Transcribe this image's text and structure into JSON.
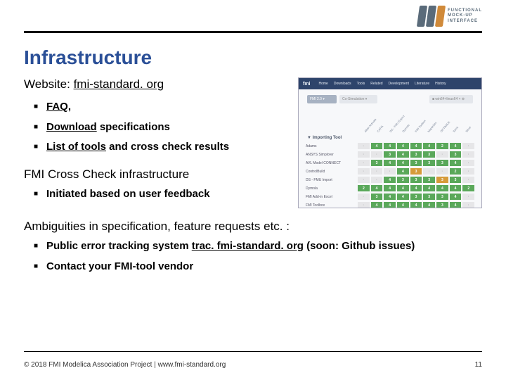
{
  "logo": {
    "line1": "FUNCTIONAL",
    "line2": "MOCK-UP",
    "line3": "INTERFACE"
  },
  "title": "Infrastructure",
  "section1": {
    "intro_prefix": "Website: ",
    "intro_link": "fmi-standard. org",
    "items": [
      {
        "link": "FAQ",
        "rest": ","
      },
      {
        "link": "Download",
        "rest": " specifications"
      },
      {
        "link": "List of tools",
        "rest": " and cross check results"
      }
    ]
  },
  "section2": {
    "head": "FMI Cross Check infrastructure",
    "items": [
      {
        "text": "Initiated based on user feedback"
      }
    ]
  },
  "section3": {
    "head": "Ambiguities in specification, feature requests etc. :",
    "items": [
      {
        "pre": "Public error tracking system ",
        "link": "trac. fmi-standard. org",
        "post": " (soon: Github issues)"
      },
      {
        "pre": "Contact your FMI-tool vendor",
        "link": "",
        "post": ""
      }
    ]
  },
  "shot": {
    "brand": "fmi",
    "nav": [
      "Home",
      "Downloads",
      "Tools",
      "Related",
      "Development",
      "Literature",
      "History"
    ],
    "pills": {
      "a": "FMI 2.0 ▾",
      "b": "Co-Simulation ▾",
      "c": "■ win64+linux64 × ⊕"
    },
    "diag_cols": [
      "Altair Activate",
      "CATIA",
      "DS - FMU Export",
      "Dymola",
      "FMI Toolbox",
      "MapleSim",
      "OPTIMICA",
      "SimX",
      "Silver"
    ],
    "table_label": "▼ Importing Tool",
    "rows": [
      {
        "name": "Adams",
        "cells": [
          "x",
          "g:4",
          "g:4",
          "g:4",
          "g:4",
          "g:4",
          "g:2",
          "g:4",
          "x"
        ]
      },
      {
        "name": "ANSYS Simplorer",
        "cells": [
          "x",
          "x",
          "g:3",
          "g:4",
          "g:3",
          "g:3",
          "x",
          "g:3",
          "x"
        ]
      },
      {
        "name": "AVL Model CONNECT",
        "cells": [
          "x",
          "g:3",
          "g:4",
          "g:4",
          "g:3",
          "g:3",
          "g:3",
          "g:4",
          "x"
        ]
      },
      {
        "name": "ControlBuild",
        "cells": [
          "x",
          "x",
          "x",
          "g:4",
          "o:3",
          "x",
          "x",
          "g:2",
          "x"
        ]
      },
      {
        "name": "DS - FMU Import",
        "cells": [
          "x",
          "x",
          "g:4",
          "g:3",
          "g:3",
          "g:3",
          "o:3",
          "g:3",
          "x"
        ]
      },
      {
        "name": "Dymola",
        "cells": [
          "g:2",
          "g:4",
          "g:4",
          "g:4",
          "g:4",
          "g:4",
          "g:4",
          "g:4",
          "g:2"
        ]
      },
      {
        "name": "FMI Add-in Excel",
        "cells": [
          "x",
          "g:3",
          "g:4",
          "g:4",
          "g:3",
          "g:3",
          "g:3",
          "g:4",
          "x"
        ]
      },
      {
        "name": "FMI Toolbox",
        "cells": [
          "x",
          "g:4",
          "g:4",
          "g:4",
          "g:4",
          "g:4",
          "g:3",
          "g:4",
          "x"
        ]
      }
    ]
  },
  "footer": {
    "left": "© 2018 FMI Modelica Association Project | www.fmi-standard.org",
    "right": "11"
  }
}
